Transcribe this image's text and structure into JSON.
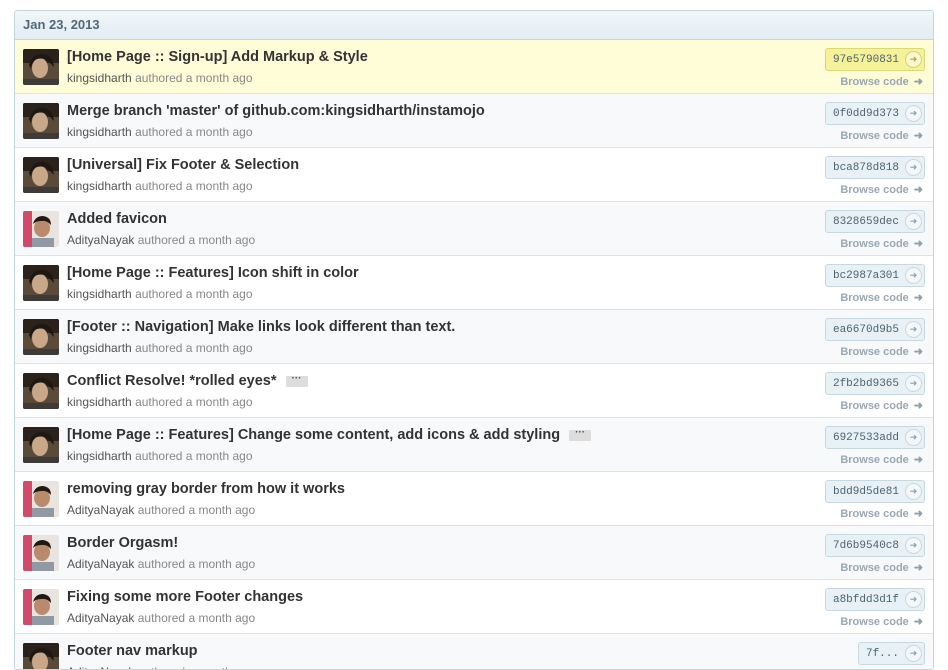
{
  "group": {
    "date": "Jan 23, 2013"
  },
  "labels": {
    "authored": "authored",
    "browse_code": "Browse code",
    "ellipsis": "···"
  },
  "commits": [
    {
      "message": "[Home Page :: Sign-up] Add Markup & Style",
      "author": "kingsidharth",
      "time": "a month ago",
      "sha": "97e5790831",
      "avatar": "kingsidharth-avatar",
      "has_more": false
    },
    {
      "message": "Merge branch 'master' of github.com:kingsidharth/instamojo",
      "author": "kingsidharth",
      "time": "a month ago",
      "sha": "0f0dd9d373",
      "avatar": "kingsidharth-avatar",
      "has_more": false
    },
    {
      "message": "[Universal] Fix Footer & Selection",
      "author": "kingsidharth",
      "time": "a month ago",
      "sha": "bca878d818",
      "avatar": "kingsidharth-avatar",
      "has_more": false
    },
    {
      "message": "Added favicon",
      "author": "AdityaNayak",
      "time": "a month ago",
      "sha": "8328659dec",
      "avatar": "adityanayak-avatar",
      "has_more": false
    },
    {
      "message": "[Home Page :: Features] Icon shift in color",
      "author": "kingsidharth",
      "time": "a month ago",
      "sha": "bc2987a301",
      "avatar": "kingsidharth-avatar",
      "has_more": false
    },
    {
      "message": "[Footer :: Navigation] Make links look different than text.",
      "author": "kingsidharth",
      "time": "a month ago",
      "sha": "ea6670d9b5",
      "avatar": "kingsidharth-avatar",
      "has_more": false
    },
    {
      "message": "Conflict Resolve! *rolled eyes*",
      "author": "kingsidharth",
      "time": "a month ago",
      "sha": "2fb2bd9365",
      "avatar": "kingsidharth-avatar",
      "has_more": true
    },
    {
      "message": "[Home Page :: Features] Change some content, add icons & add styling",
      "author": "kingsidharth",
      "time": "a month ago",
      "sha": "6927533add",
      "avatar": "kingsidharth-avatar",
      "has_more": true
    },
    {
      "message": "removing gray border from how it works",
      "author": "AdityaNayak",
      "time": "a month ago",
      "sha": "bdd9d5de81",
      "avatar": "adityanayak-avatar",
      "has_more": false
    },
    {
      "message": "Border Orgasm!",
      "author": "AdityaNayak",
      "time": "a month ago",
      "sha": "7d6b9540c8",
      "avatar": "adityanayak-avatar",
      "has_more": false
    },
    {
      "message": "Fixing some more Footer changes",
      "author": "AdityaNayak",
      "time": "a month ago",
      "sha": "a8bfdd3d1f",
      "avatar": "adityanayak-avatar",
      "has_more": false
    },
    {
      "message": "Footer nav markup",
      "author": "AdityaNayak",
      "time": "a month ago",
      "sha": "7f...",
      "avatar": "kingsidharth-avatar",
      "has_more": false
    }
  ],
  "colors": {
    "highlight_row": "#fffcd8",
    "header_bg": "#e8f1f6",
    "sha_bg": "#e8f1f6"
  }
}
